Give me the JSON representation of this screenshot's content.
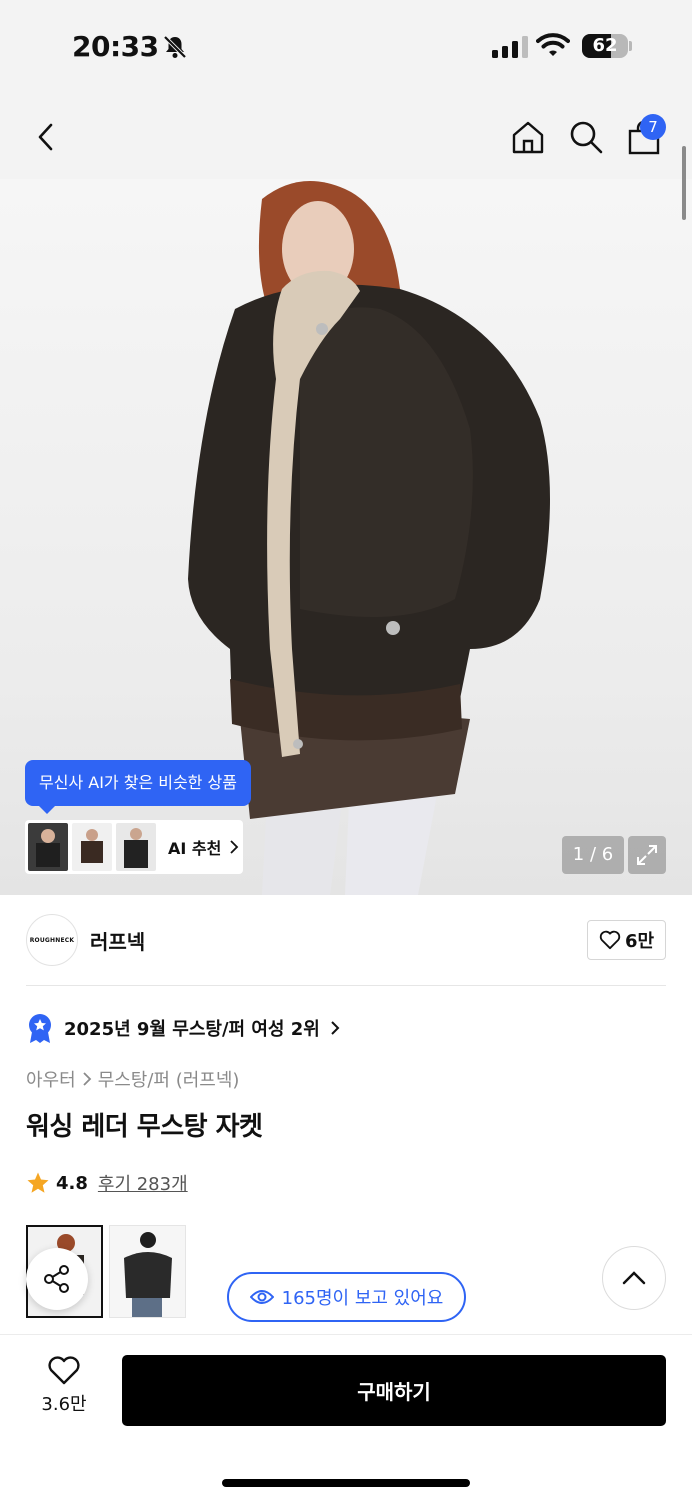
{
  "status_bar": {
    "time": "20:33",
    "battery_level": "62",
    "battery_fraction": 0.62,
    "icons": [
      "bell-slash-icon",
      "signal-icon",
      "wifi-icon",
      "battery-icon"
    ]
  },
  "nav": {
    "icons": [
      "back-icon",
      "home-icon",
      "search-icon",
      "cart-icon"
    ],
    "cart_count": "7"
  },
  "hero": {
    "ai_tooltip": "무신사 AI가 찾은 비슷한 상품",
    "ai_recommend_label": "AI 추천",
    "image_counter": "1 / 6"
  },
  "brand": {
    "logo_text": "ROUGHNECK",
    "name": "러프넥",
    "likes": "6만"
  },
  "ranking": {
    "text": "2025년 9월 무스탕/퍼 여성 2위"
  },
  "breadcrumb": {
    "category": "아우터",
    "subcategory": "무스탕/퍼 (러프넥)"
  },
  "product": {
    "title": "워싱 레더 무스탕 자켓",
    "rating": "4.8",
    "reviews": "후기 283개"
  },
  "viewers": {
    "text": "165명이 보고 있어요"
  },
  "bottom_bar": {
    "wish_count": "3.6만",
    "buy_label": "구매하기"
  },
  "colors": {
    "accent": "#2f64f4",
    "star": "#f5a623",
    "buy_button": "#000000"
  }
}
